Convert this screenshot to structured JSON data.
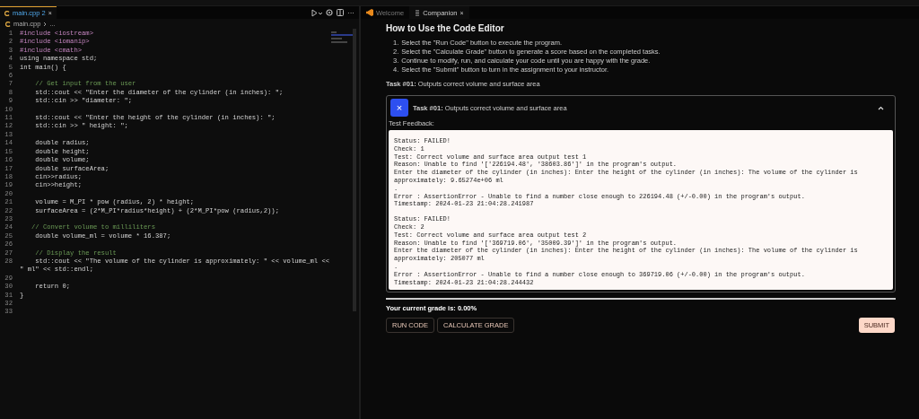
{
  "editor": {
    "tab": {
      "label": "main.cpp",
      "badge": "2",
      "close": "×"
    },
    "breadcrumb": [
      "main.cpp",
      "..."
    ],
    "toolbar_more": "···",
    "lines": [
      {
        "n": "1",
        "kind": "directive",
        "code": "#include <iostream>"
      },
      {
        "n": "2",
        "kind": "directive",
        "code": "#include <iomanip>"
      },
      {
        "n": "3",
        "kind": "directive",
        "code": "#include <cmath>"
      },
      {
        "n": "4",
        "kind": "code",
        "code": "using namespace std;"
      },
      {
        "n": "5",
        "kind": "code",
        "code": "int main() {"
      },
      {
        "n": "6"
      },
      {
        "n": "7",
        "kind": "comment",
        "code": "    // Get input from the user"
      },
      {
        "n": "8",
        "kind": "code",
        "code": "    std::cout << \"Enter the diameter of the cylinder (in inches): \";"
      },
      {
        "n": "9",
        "kind": "code",
        "code": "    std::cin >> \"diameter: \";"
      },
      {
        "n": "10"
      },
      {
        "n": "11",
        "kind": "code",
        "code": "    std::cout << \"Enter the height of the cylinder (in inches): \";"
      },
      {
        "n": "12",
        "kind": "code",
        "code": "    std::cin >> \" height: \";"
      },
      {
        "n": "13"
      },
      {
        "n": "14",
        "kind": "code",
        "code": "    double radius;"
      },
      {
        "n": "15",
        "kind": "code",
        "code": "    double height;"
      },
      {
        "n": "16",
        "kind": "code",
        "code": "    double volume;"
      },
      {
        "n": "17",
        "kind": "code",
        "code": "    double surfaceArea;"
      },
      {
        "n": "18",
        "kind": "code",
        "code": "    cin>>radius;"
      },
      {
        "n": "19",
        "kind": "code",
        "code": "    cin>>height;"
      },
      {
        "n": "20"
      },
      {
        "n": "21",
        "kind": "code",
        "code": "    volume = M_PI * pow (radius, 2) * height;"
      },
      {
        "n": "22",
        "kind": "code",
        "code": "    surfaceArea = (2*M_PI*radius*height) + (2*M_PI*pow (radius,2));"
      },
      {
        "n": "23"
      },
      {
        "n": "24",
        "kind": "comment",
        "code": "   // Convert volume to milliliters"
      },
      {
        "n": "25",
        "kind": "code",
        "code": "    double volume_ml = volume * 16.387;"
      },
      {
        "n": "26"
      },
      {
        "n": "27",
        "kind": "comment",
        "code": "    // Display the result"
      },
      {
        "n": "28",
        "kind": "code",
        "code": "    std::cout << \"The volume of the cylinder is approximately: \" << volume_ml << \" ml\" << std::endl;"
      },
      {
        "n": "29"
      },
      {
        "n": "30",
        "kind": "code",
        "code": "    return 0;"
      },
      {
        "n": "31",
        "kind": "code",
        "code": "}"
      },
      {
        "n": "32"
      },
      {
        "n": "33"
      }
    ]
  },
  "companion": {
    "tabs": [
      {
        "label": "Welcome",
        "selected": false
      },
      {
        "label": "Companion",
        "selected": true,
        "close": "×"
      }
    ],
    "title": "How to Use the Code Editor",
    "steps": [
      {
        "n": "1.",
        "text": "Select the \"Run Code\" button to execute the program."
      },
      {
        "n": "2.",
        "text": "Select the \"Calculate Grade\" button to generate a score based on the completed tasks."
      },
      {
        "n": "3.",
        "text": "Continue to modify, run, and calculate your code until you are happy with the grade."
      },
      {
        "n": "4.",
        "text": "Select the \"Submit\" button to turn in the assignment to your instructor."
      }
    ],
    "task_summary": "**Task #01:** Outputs correct volume and surface area",
    "task": {
      "icon": "×",
      "label": "**Task #01:** Outputs correct volume and surface area",
      "expanded": true,
      "feedback_label": "Test Feedback:",
      "feedback": [
        [
          "Status: FAILED!",
          "Check: 1",
          "Test: Correct volume and surface area output test 1",
          "Reason: Unable to find '['226194.48', '38603.86']' in the program's output.",
          "Enter the diameter of the cylinder (in inches): Enter the height of the cylinder (in inches): The volume of the cylinder is approximately: 9.65274e+06 ml",
          ".",
          "Error : AssertionError - Unable to find a number close enough to 226194.48 (+/-0.00) in the program's output.",
          "Timestamp: 2024-01-23 21:04:28.241987"
        ],
        [
          "Status: FAILED!",
          "Check: 2",
          "Test: Correct volume and surface area output test 2",
          "Reason: Unable to find '['369719.06', '35009.39']' in the program's output.",
          "Enter the diameter of the cylinder (in inches): Enter the height of the cylinder (in inches): The volume of the cylinder is approximately: 205077 ml",
          ".",
          "Error : AssertionError - Unable to find a number close enough to 369719.06 (+/-0.00) in the program's output.",
          "Timestamp: 2024-01-23 21:04:28.244432"
        ]
      ]
    },
    "grade": "Your current grade is: 0.00%",
    "buttons": [
      {
        "label": "RUN CODE",
        "kind": "outline"
      },
      {
        "label": "CALCULATE GRADE",
        "kind": "outline"
      },
      {
        "label": "SUBMIT",
        "kind": "primary"
      }
    ]
  }
}
